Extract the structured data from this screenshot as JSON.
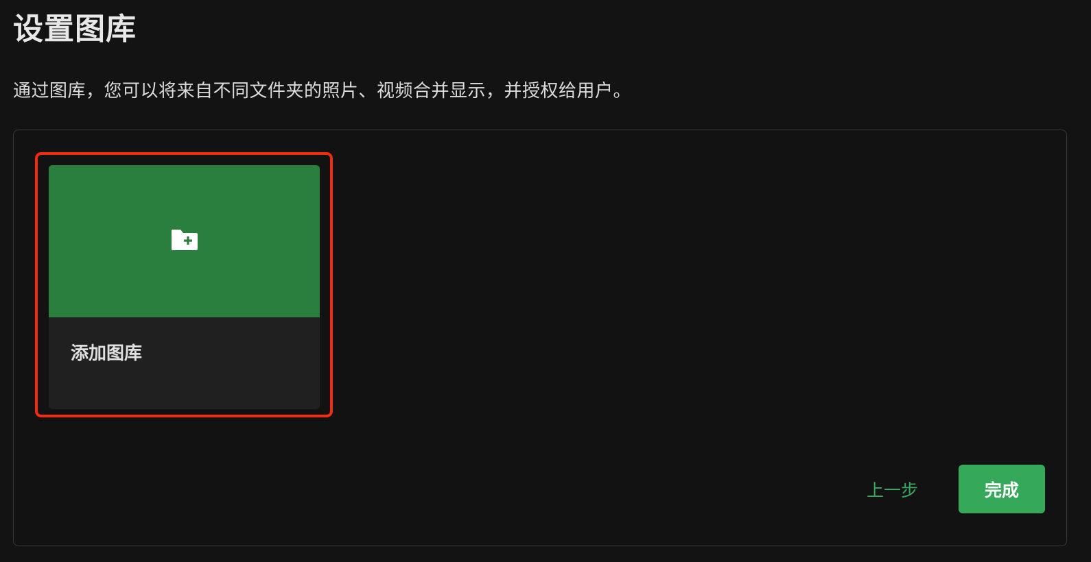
{
  "header": {
    "title": "设置图库",
    "description": "通过图库，您可以将来自不同文件夹的照片、视频合并显示，并授权给用户。"
  },
  "library_card": {
    "label": "添加图库",
    "icon": "folder-add-icon",
    "cover_color": "#2a7f3e"
  },
  "footer": {
    "back_label": "上一步",
    "done_label": "完成"
  },
  "colors": {
    "accent": "#35a85a",
    "highlight": "#f22c0d",
    "background": "#131313"
  }
}
